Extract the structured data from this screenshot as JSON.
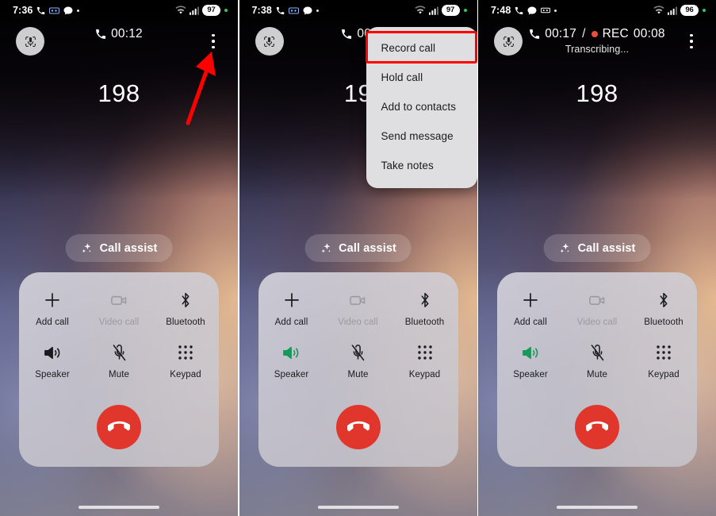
{
  "panels": [
    {
      "id": "panel-1",
      "status_bar": {
        "time": "7:36",
        "left_icons": [
          "phone-icon",
          "voicemail-icon",
          "chat-bubble-icon",
          "dot-icon"
        ],
        "right_icons": [
          "wifi-icon",
          "signal-bars-icon"
        ],
        "battery": "97",
        "battery_dot": "green-dot-icon"
      },
      "header": {
        "mic_button": "mic-scan-icon",
        "call_timer": "00:12",
        "phone_icon": "phone-icon",
        "overflow": "more-vertical-icon",
        "show_rec": false,
        "rec_label": "",
        "rec_timer": "",
        "separator": "",
        "sub_status": ""
      },
      "caller_number": "198",
      "assist": {
        "label": "Call assist",
        "icon": "sparkle-icon"
      },
      "controls": [
        {
          "label": "Add call",
          "icon": "plus-icon",
          "state": "normal"
        },
        {
          "label": "Video call",
          "icon": "video-camera-icon",
          "state": "disabled"
        },
        {
          "label": "Bluetooth",
          "icon": "bluetooth-icon",
          "state": "normal"
        },
        {
          "label": "Speaker",
          "icon": "speaker-icon",
          "state": "normal"
        },
        {
          "label": "Mute",
          "icon": "mic-muted-icon",
          "state": "normal"
        },
        {
          "label": "Keypad",
          "icon": "dialpad-icon",
          "state": "normal"
        }
      ],
      "end_call": {
        "icon": "end-call-icon",
        "color": "#e0362c"
      },
      "menu": null,
      "annotation": {
        "type": "arrow",
        "color": "#ff0000",
        "points_to": "more-vertical-icon"
      }
    },
    {
      "id": "panel-2",
      "status_bar": {
        "time": "7:38",
        "left_icons": [
          "phone-icon",
          "voicemail-icon",
          "chat-bubble-icon",
          "dot-icon"
        ],
        "right_icons": [
          "wifi-icon",
          "signal-bars-icon"
        ],
        "battery": "97",
        "battery_dot": "green-dot-icon"
      },
      "header": {
        "mic_button": "mic-scan-icon",
        "call_timer": "00:",
        "phone_icon": "phone-icon",
        "overflow": "more-vertical-icon",
        "show_rec": false,
        "rec_label": "",
        "rec_timer": "",
        "separator": "",
        "sub_status": ""
      },
      "caller_number": "19",
      "assist": {
        "label": "Call assist",
        "icon": "sparkle-icon"
      },
      "controls": [
        {
          "label": "Add call",
          "icon": "plus-icon",
          "state": "normal"
        },
        {
          "label": "Video call",
          "icon": "video-camera-icon",
          "state": "disabled"
        },
        {
          "label": "Bluetooth",
          "icon": "bluetooth-icon",
          "state": "normal"
        },
        {
          "label": "Speaker",
          "icon": "speaker-icon",
          "state": "active"
        },
        {
          "label": "Mute",
          "icon": "mic-muted-icon",
          "state": "normal"
        },
        {
          "label": "Keypad",
          "icon": "dialpad-icon",
          "state": "normal"
        }
      ],
      "end_call": {
        "icon": "end-call-icon",
        "color": "#e0362c"
      },
      "menu": {
        "items": [
          "Record call",
          "Hold call",
          "Add to contacts",
          "Send message",
          "Take notes"
        ],
        "highlighted_index": 0,
        "highlight_color": "#ff0000"
      },
      "annotation": null
    },
    {
      "id": "panel-3",
      "status_bar": {
        "time": "7:48",
        "left_icons": [
          "phone-icon",
          "chat-bubble-icon",
          "voicemail-icon",
          "dot-icon"
        ],
        "right_icons": [
          "wifi-icon",
          "signal-bars-icon"
        ],
        "battery": "96",
        "battery_dot": "green-dot-icon"
      },
      "header": {
        "mic_button": "mic-scan-icon",
        "call_timer": "00:17",
        "phone_icon": "phone-icon",
        "overflow": "more-vertical-icon",
        "show_rec": true,
        "separator": "/",
        "rec_label": "REC",
        "rec_timer": "00:08",
        "rec_dot_color": "#e8503a",
        "sub_status": "Transcribing..."
      },
      "caller_number": "198",
      "assist": {
        "label": "Call assist",
        "icon": "sparkle-icon"
      },
      "controls": [
        {
          "label": "Add call",
          "icon": "plus-icon",
          "state": "normal"
        },
        {
          "label": "Video call",
          "icon": "video-camera-icon",
          "state": "disabled"
        },
        {
          "label": "Bluetooth",
          "icon": "bluetooth-icon",
          "state": "normal"
        },
        {
          "label": "Speaker",
          "icon": "speaker-icon",
          "state": "active"
        },
        {
          "label": "Mute",
          "icon": "mic-muted-icon",
          "state": "normal"
        },
        {
          "label": "Keypad",
          "icon": "dialpad-icon",
          "state": "normal"
        }
      ],
      "end_call": {
        "icon": "end-call-icon",
        "color": "#e0362c"
      },
      "menu": null,
      "annotation": null
    }
  ],
  "colors": {
    "accent_green": "#0f9d58",
    "end_call_red": "#e0362c",
    "rec_red": "#e8503a",
    "highlight_red": "#ff0000",
    "battery_green_dot": "#35c759"
  }
}
